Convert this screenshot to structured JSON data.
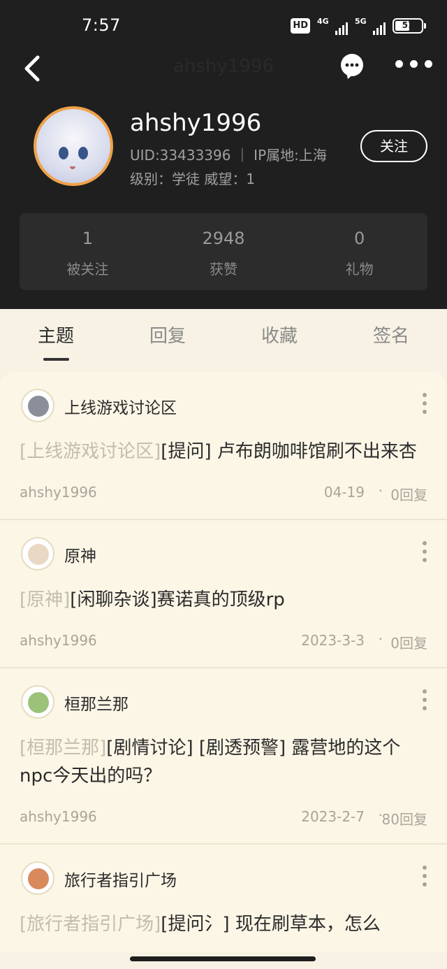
{
  "status_bar": {
    "time": "7:57",
    "hd": "HD",
    "net1": "4G",
    "net2": "5G",
    "battery": "51"
  },
  "nav": {
    "title": "ahshy1996"
  },
  "profile": {
    "username": "ahshy1996",
    "uid_line": "UID:33433396 ｜ IP属地:上海",
    "level_line": "级别：学徒   威望：1",
    "follow_label": "关注"
  },
  "stats": [
    {
      "value": "1",
      "label": "被关注"
    },
    {
      "value": "2948",
      "label": "获赞"
    },
    {
      "value": "0",
      "label": "礼物"
    }
  ],
  "tabs": [
    {
      "label": "主题",
      "active": true
    },
    {
      "label": "回复",
      "active": false
    },
    {
      "label": "收藏",
      "active": false
    },
    {
      "label": "签名",
      "active": false
    }
  ],
  "posts": [
    {
      "forum": "上线游戏讨论区",
      "tag": "[上线游戏讨论区]",
      "title": "[提问] 卢布朗咖啡馆刷不出来杏",
      "author": "ahshy1996",
      "date": "04-19",
      "replies": "0回复"
    },
    {
      "forum": "原神",
      "tag": "[原神]",
      "title": "[闲聊杂谈]赛诺真的顶级rp",
      "author": "ahshy1996",
      "date": "2023-3-3",
      "replies": "0回复"
    },
    {
      "forum": "桓那兰那",
      "tag": "[桓那兰那]",
      "title": "[剧情讨论] [剧透预警] 露营地的这个npc今天出的吗？",
      "author": "ahshy1996",
      "date": "2023-2-7",
      "replies": "80回复"
    },
    {
      "forum": "旅行者指引广场",
      "tag": "[旅行者指引广场]",
      "title": "[提问氵] 现在刷草本，怎么",
      "author": "",
      "date": "",
      "replies": ""
    }
  ],
  "colors": {
    "header_bg": "#1f1f1f",
    "page_bg": "#f7f2e4",
    "accent_avatar": "#f0a24a"
  }
}
